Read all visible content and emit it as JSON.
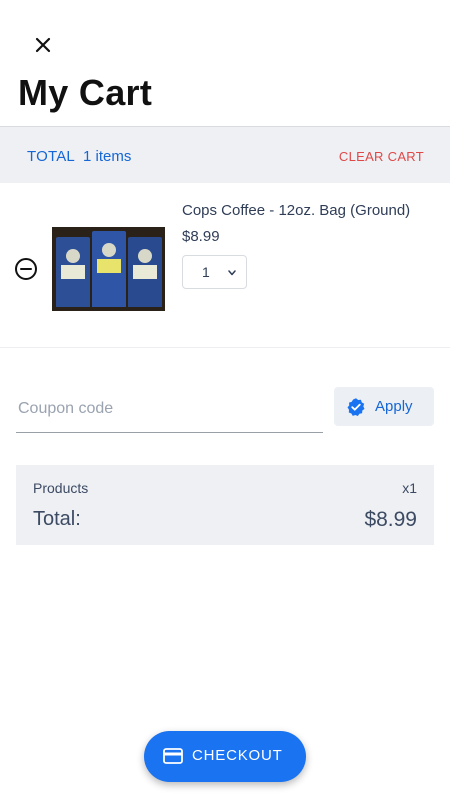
{
  "header": {
    "close_icon": "close-icon",
    "title": "My Cart"
  },
  "summary": {
    "total_label": "TOTAL",
    "item_count": "1 items",
    "clear_label": "CLEAR CART"
  },
  "cart": {
    "items": [
      {
        "name": "Cops Coffee - 12oz. Bag (Ground)",
        "price": "$8.99",
        "quantity": "1",
        "remove_icon": "minus-circle-icon",
        "image_name": "coffee-bags-image"
      }
    ]
  },
  "coupon": {
    "placeholder": "Coupon code",
    "value": "",
    "apply_label": "Apply",
    "apply_icon": "verified-check-icon"
  },
  "totals": {
    "products_label": "Products",
    "products_count": "x1",
    "total_label": "Total:",
    "total_value": "$8.99"
  },
  "checkout": {
    "label": "CHECKOUT",
    "icon": "credit-card-icon"
  },
  "colors": {
    "accent": "#1a73f0",
    "link_blue": "#1566d6",
    "danger": "#e04848",
    "panel_bg": "#eef0f3"
  }
}
